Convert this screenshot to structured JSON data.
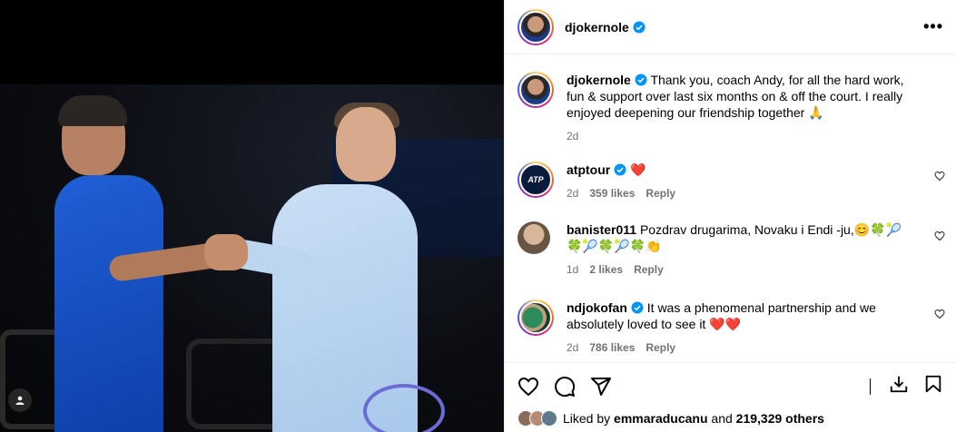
{
  "post": {
    "username": "djokernole",
    "caption": "Thank you, coach Andy, for all the hard work, fun & support over last six months on & off the court. I really enjoyed deepening our friendship together 🙏",
    "caption_age": "2d"
  },
  "comments": [
    {
      "username": "atptour",
      "verified": true,
      "text": "❤️",
      "age": "2d",
      "likes": "359 likes",
      "reply": "Reply",
      "avatar_text": "ATP"
    },
    {
      "username": "banister011",
      "verified": false,
      "text": "Pozdrav drugarima, Novaku i Endi -ju,😊🍀🎾🍀🎾🍀🎾🍀👏",
      "age": "1d",
      "likes": "2 likes",
      "reply": "Reply"
    },
    {
      "username": "ndjokofan",
      "verified": true,
      "text": "It was a phenomenal partnership and we absolutely loved to see it ❤️❤️",
      "age": "2d",
      "likes": "786 likes",
      "reply": "Reply"
    }
  ],
  "likes_line": {
    "prefix": "Liked by",
    "user": "emmaraducanu",
    "joiner": "and",
    "count": "219,329 others"
  },
  "icons": {
    "more": "more-horizontal-icon",
    "like": "heart-icon",
    "comment": "comment-icon",
    "share": "share-icon",
    "save": "bookmark-icon",
    "download": "download-icon",
    "tag": "user-tag-icon"
  },
  "colors": {
    "verified": "#0095f6",
    "muted": "#737373",
    "heart": "#ed1c24"
  }
}
